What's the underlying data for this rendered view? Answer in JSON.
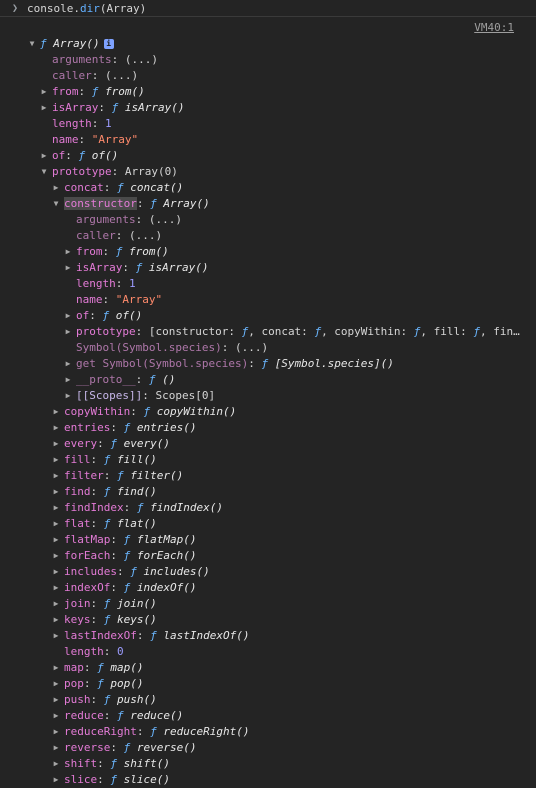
{
  "command": {
    "pre": "console.",
    "method": "dir",
    "post": "(Array)"
  },
  "source_link": "VM40:1",
  "badge": "i",
  "rows": [
    {
      "d": 0,
      "t": "open",
      "parts": [
        [
          "fn",
          "ƒ "
        ],
        [
          "fname",
          "Array()"
        ]
      ],
      "badge": true
    },
    {
      "d": 1,
      "t": "none",
      "parts": [
        [
          "kd",
          "arguments"
        ],
        [
          "pl",
          ": (...)"
        ]
      ]
    },
    {
      "d": 1,
      "t": "none",
      "parts": [
        [
          "kd",
          "caller"
        ],
        [
          "pl",
          ": (...)"
        ]
      ]
    },
    {
      "d": 1,
      "t": "closed",
      "parts": [
        [
          "k",
          "from"
        ],
        [
          "pl",
          ": "
        ],
        [
          "fn",
          "ƒ "
        ],
        [
          "fname",
          "from()"
        ]
      ]
    },
    {
      "d": 1,
      "t": "closed",
      "parts": [
        [
          "k",
          "isArray"
        ],
        [
          "pl",
          ": "
        ],
        [
          "fn",
          "ƒ "
        ],
        [
          "fname",
          "isArray()"
        ]
      ]
    },
    {
      "d": 1,
      "t": "none",
      "parts": [
        [
          "k",
          "length"
        ],
        [
          "pl",
          ": "
        ],
        [
          "num",
          "1"
        ]
      ]
    },
    {
      "d": 1,
      "t": "none",
      "parts": [
        [
          "k",
          "name"
        ],
        [
          "pl",
          ": "
        ],
        [
          "str",
          "\"Array\""
        ]
      ]
    },
    {
      "d": 1,
      "t": "closed",
      "parts": [
        [
          "k",
          "of"
        ],
        [
          "pl",
          ": "
        ],
        [
          "fn",
          "ƒ "
        ],
        [
          "fname",
          "of()"
        ]
      ]
    },
    {
      "d": 1,
      "t": "open",
      "parts": [
        [
          "k",
          "prototype"
        ],
        [
          "pl",
          ": Array(0)"
        ]
      ]
    },
    {
      "d": 2,
      "t": "closed",
      "parts": [
        [
          "k",
          "concat"
        ],
        [
          "pl",
          ": "
        ],
        [
          "fn",
          "ƒ "
        ],
        [
          "fname",
          "concat()"
        ]
      ]
    },
    {
      "d": 2,
      "t": "open",
      "hl": true,
      "parts": [
        [
          "k",
          "constructor"
        ],
        [
          "pl",
          ": "
        ],
        [
          "fn",
          "ƒ "
        ],
        [
          "fname",
          "Array()"
        ]
      ]
    },
    {
      "d": 3,
      "t": "none",
      "parts": [
        [
          "kd",
          "arguments"
        ],
        [
          "pl",
          ": (...)"
        ]
      ]
    },
    {
      "d": 3,
      "t": "none",
      "parts": [
        [
          "kd",
          "caller"
        ],
        [
          "pl",
          ": (...)"
        ]
      ]
    },
    {
      "d": 3,
      "t": "closed",
      "parts": [
        [
          "k",
          "from"
        ],
        [
          "pl",
          ": "
        ],
        [
          "fn",
          "ƒ "
        ],
        [
          "fname",
          "from()"
        ]
      ]
    },
    {
      "d": 3,
      "t": "closed",
      "parts": [
        [
          "k",
          "isArray"
        ],
        [
          "pl",
          ": "
        ],
        [
          "fn",
          "ƒ "
        ],
        [
          "fname",
          "isArray()"
        ]
      ]
    },
    {
      "d": 3,
      "t": "none",
      "parts": [
        [
          "k",
          "length"
        ],
        [
          "pl",
          ": "
        ],
        [
          "num",
          "1"
        ]
      ]
    },
    {
      "d": 3,
      "t": "none",
      "parts": [
        [
          "k",
          "name"
        ],
        [
          "pl",
          ": "
        ],
        [
          "str",
          "\"Array\""
        ]
      ]
    },
    {
      "d": 3,
      "t": "closed",
      "parts": [
        [
          "k",
          "of"
        ],
        [
          "pl",
          ": "
        ],
        [
          "fn",
          "ƒ "
        ],
        [
          "fname",
          "of()"
        ]
      ]
    },
    {
      "d": 3,
      "t": "closed",
      "parts": [
        [
          "k",
          "prototype"
        ],
        [
          "pl",
          ": [constructor: "
        ],
        [
          "fn",
          "ƒ"
        ],
        [
          "pl",
          ", concat: "
        ],
        [
          "fn",
          "ƒ"
        ],
        [
          "pl",
          ", copyWithin: "
        ],
        [
          "fn",
          "ƒ"
        ],
        [
          "pl",
          ", fill: "
        ],
        [
          "fn",
          "ƒ"
        ],
        [
          "pl",
          ", fin…"
        ]
      ]
    },
    {
      "d": 3,
      "t": "none",
      "parts": [
        [
          "kd",
          "Symbol(Symbol.species)"
        ],
        [
          "pl",
          ": (...)"
        ]
      ]
    },
    {
      "d": 3,
      "t": "closed",
      "parts": [
        [
          "kd",
          "get Symbol(Symbol.species)"
        ],
        [
          "pl",
          ": "
        ],
        [
          "fn",
          "ƒ "
        ],
        [
          "fname",
          "[Symbol.species]()"
        ]
      ]
    },
    {
      "d": 3,
      "t": "closed",
      "parts": [
        [
          "kd",
          "__proto__"
        ],
        [
          "pl",
          ": "
        ],
        [
          "fn",
          "ƒ "
        ],
        [
          "fname",
          "()"
        ]
      ]
    },
    {
      "d": 3,
      "t": "closed",
      "parts": [
        [
          "sym",
          "[[Scopes]]"
        ],
        [
          "pl",
          ": Scopes[0]"
        ]
      ]
    },
    {
      "d": 2,
      "t": "closed",
      "parts": [
        [
          "k",
          "copyWithin"
        ],
        [
          "pl",
          ": "
        ],
        [
          "fn",
          "ƒ "
        ],
        [
          "fname",
          "copyWithin()"
        ]
      ]
    },
    {
      "d": 2,
      "t": "closed",
      "parts": [
        [
          "k",
          "entries"
        ],
        [
          "pl",
          ": "
        ],
        [
          "fn",
          "ƒ "
        ],
        [
          "fname",
          "entries()"
        ]
      ]
    },
    {
      "d": 2,
      "t": "closed",
      "parts": [
        [
          "k",
          "every"
        ],
        [
          "pl",
          ": "
        ],
        [
          "fn",
          "ƒ "
        ],
        [
          "fname",
          "every()"
        ]
      ]
    },
    {
      "d": 2,
      "t": "closed",
      "parts": [
        [
          "k",
          "fill"
        ],
        [
          "pl",
          ": "
        ],
        [
          "fn",
          "ƒ "
        ],
        [
          "fname",
          "fill()"
        ]
      ]
    },
    {
      "d": 2,
      "t": "closed",
      "parts": [
        [
          "k",
          "filter"
        ],
        [
          "pl",
          ": "
        ],
        [
          "fn",
          "ƒ "
        ],
        [
          "fname",
          "filter()"
        ]
      ]
    },
    {
      "d": 2,
      "t": "closed",
      "parts": [
        [
          "k",
          "find"
        ],
        [
          "pl",
          ": "
        ],
        [
          "fn",
          "ƒ "
        ],
        [
          "fname",
          "find()"
        ]
      ]
    },
    {
      "d": 2,
      "t": "closed",
      "parts": [
        [
          "k",
          "findIndex"
        ],
        [
          "pl",
          ": "
        ],
        [
          "fn",
          "ƒ "
        ],
        [
          "fname",
          "findIndex()"
        ]
      ]
    },
    {
      "d": 2,
      "t": "closed",
      "parts": [
        [
          "k",
          "flat"
        ],
        [
          "pl",
          ": "
        ],
        [
          "fn",
          "ƒ "
        ],
        [
          "fname",
          "flat()"
        ]
      ]
    },
    {
      "d": 2,
      "t": "closed",
      "parts": [
        [
          "k",
          "flatMap"
        ],
        [
          "pl",
          ": "
        ],
        [
          "fn",
          "ƒ "
        ],
        [
          "fname",
          "flatMap()"
        ]
      ]
    },
    {
      "d": 2,
      "t": "closed",
      "parts": [
        [
          "k",
          "forEach"
        ],
        [
          "pl",
          ": "
        ],
        [
          "fn",
          "ƒ "
        ],
        [
          "fname",
          "forEach()"
        ]
      ]
    },
    {
      "d": 2,
      "t": "closed",
      "parts": [
        [
          "k",
          "includes"
        ],
        [
          "pl",
          ": "
        ],
        [
          "fn",
          "ƒ "
        ],
        [
          "fname",
          "includes()"
        ]
      ]
    },
    {
      "d": 2,
      "t": "closed",
      "parts": [
        [
          "k",
          "indexOf"
        ],
        [
          "pl",
          ": "
        ],
        [
          "fn",
          "ƒ "
        ],
        [
          "fname",
          "indexOf()"
        ]
      ]
    },
    {
      "d": 2,
      "t": "closed",
      "parts": [
        [
          "k",
          "join"
        ],
        [
          "pl",
          ": "
        ],
        [
          "fn",
          "ƒ "
        ],
        [
          "fname",
          "join()"
        ]
      ]
    },
    {
      "d": 2,
      "t": "closed",
      "parts": [
        [
          "k",
          "keys"
        ],
        [
          "pl",
          ": "
        ],
        [
          "fn",
          "ƒ "
        ],
        [
          "fname",
          "keys()"
        ]
      ]
    },
    {
      "d": 2,
      "t": "closed",
      "parts": [
        [
          "k",
          "lastIndexOf"
        ],
        [
          "pl",
          ": "
        ],
        [
          "fn",
          "ƒ "
        ],
        [
          "fname",
          "lastIndexOf()"
        ]
      ]
    },
    {
      "d": 2,
      "t": "none",
      "parts": [
        [
          "k",
          "length"
        ],
        [
          "pl",
          ": "
        ],
        [
          "num",
          "0"
        ]
      ]
    },
    {
      "d": 2,
      "t": "closed",
      "parts": [
        [
          "k",
          "map"
        ],
        [
          "pl",
          ": "
        ],
        [
          "fn",
          "ƒ "
        ],
        [
          "fname",
          "map()"
        ]
      ]
    },
    {
      "d": 2,
      "t": "closed",
      "parts": [
        [
          "k",
          "pop"
        ],
        [
          "pl",
          ": "
        ],
        [
          "fn",
          "ƒ "
        ],
        [
          "fname",
          "pop()"
        ]
      ]
    },
    {
      "d": 2,
      "t": "closed",
      "parts": [
        [
          "k",
          "push"
        ],
        [
          "pl",
          ": "
        ],
        [
          "fn",
          "ƒ "
        ],
        [
          "fname",
          "push()"
        ]
      ]
    },
    {
      "d": 2,
      "t": "closed",
      "parts": [
        [
          "k",
          "reduce"
        ],
        [
          "pl",
          ": "
        ],
        [
          "fn",
          "ƒ "
        ],
        [
          "fname",
          "reduce()"
        ]
      ]
    },
    {
      "d": 2,
      "t": "closed",
      "parts": [
        [
          "k",
          "reduceRight"
        ],
        [
          "pl",
          ": "
        ],
        [
          "fn",
          "ƒ "
        ],
        [
          "fname",
          "reduceRight()"
        ]
      ]
    },
    {
      "d": 2,
      "t": "closed",
      "parts": [
        [
          "k",
          "reverse"
        ],
        [
          "pl",
          ": "
        ],
        [
          "fn",
          "ƒ "
        ],
        [
          "fname",
          "reverse()"
        ]
      ]
    },
    {
      "d": 2,
      "t": "closed",
      "parts": [
        [
          "k",
          "shift"
        ],
        [
          "pl",
          ": "
        ],
        [
          "fn",
          "ƒ "
        ],
        [
          "fname",
          "shift()"
        ]
      ]
    },
    {
      "d": 2,
      "t": "closed",
      "parts": [
        [
          "k",
          "slice"
        ],
        [
          "pl",
          ": "
        ],
        [
          "fn",
          "ƒ "
        ],
        [
          "fname",
          "slice()"
        ]
      ]
    }
  ]
}
